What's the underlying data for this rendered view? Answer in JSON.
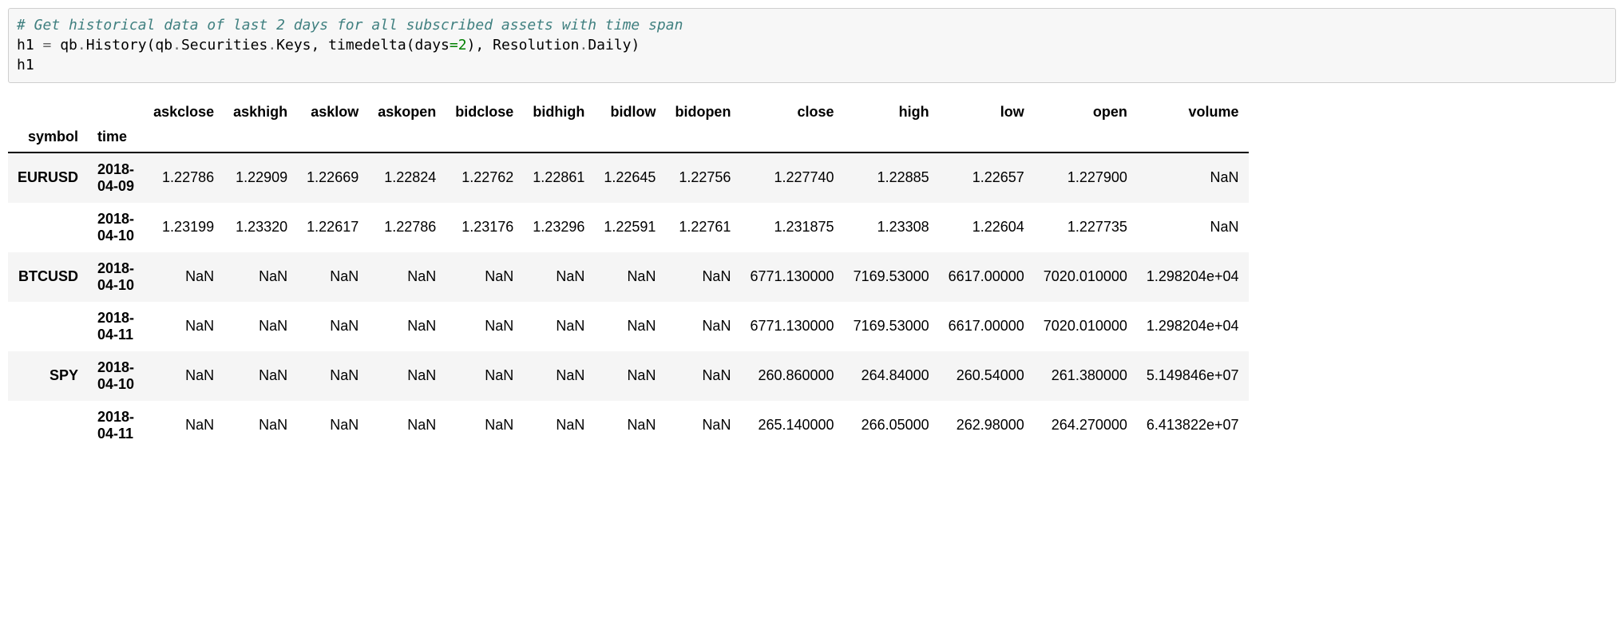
{
  "code": {
    "comment": "# Get historical data of last 2 days for all subscribed assets with time span",
    "line2_pre": "h1 ",
    "line2_eq": "=",
    "line2_a": " qb",
    "line2_dot1": ".",
    "line2_b": "History(qb",
    "line2_dot2": ".",
    "line2_c": "Securities",
    "line2_dot3": ".",
    "line2_d": "Keys, timedelta(days",
    "line2_eq2": "=",
    "line2_num": "2",
    "line2_e": "), Resolution",
    "line2_dot4": ".",
    "line2_f": "Daily)",
    "line3": "h1"
  },
  "table": {
    "index_names": [
      "symbol",
      "time"
    ],
    "columns": [
      "askclose",
      "askhigh",
      "asklow",
      "askopen",
      "bidclose",
      "bidhigh",
      "bidlow",
      "bidopen",
      "close",
      "high",
      "low",
      "open",
      "volume"
    ],
    "rows": [
      {
        "symbol": "EURUSD",
        "time": "2018-04-09",
        "cells": [
          "1.22786",
          "1.22909",
          "1.22669",
          "1.22824",
          "1.22762",
          "1.22861",
          "1.22645",
          "1.22756",
          "1.227740",
          "1.22885",
          "1.22657",
          "1.227900",
          "NaN"
        ]
      },
      {
        "symbol": "",
        "time": "2018-04-10",
        "cells": [
          "1.23199",
          "1.23320",
          "1.22617",
          "1.22786",
          "1.23176",
          "1.23296",
          "1.22591",
          "1.22761",
          "1.231875",
          "1.23308",
          "1.22604",
          "1.227735",
          "NaN"
        ]
      },
      {
        "symbol": "BTCUSD",
        "time": "2018-04-10",
        "cells": [
          "NaN",
          "NaN",
          "NaN",
          "NaN",
          "NaN",
          "NaN",
          "NaN",
          "NaN",
          "6771.130000",
          "7169.53000",
          "6617.00000",
          "7020.010000",
          "1.298204e+04"
        ]
      },
      {
        "symbol": "",
        "time": "2018-04-11",
        "cells": [
          "NaN",
          "NaN",
          "NaN",
          "NaN",
          "NaN",
          "NaN",
          "NaN",
          "NaN",
          "6771.130000",
          "7169.53000",
          "6617.00000",
          "7020.010000",
          "1.298204e+04"
        ]
      },
      {
        "symbol": "SPY",
        "time": "2018-04-10",
        "cells": [
          "NaN",
          "NaN",
          "NaN",
          "NaN",
          "NaN",
          "NaN",
          "NaN",
          "NaN",
          "260.860000",
          "264.84000",
          "260.54000",
          "261.380000",
          "5.149846e+07"
        ]
      },
      {
        "symbol": "",
        "time": "2018-04-11",
        "cells": [
          "NaN",
          "NaN",
          "NaN",
          "NaN",
          "NaN",
          "NaN",
          "NaN",
          "NaN",
          "265.140000",
          "266.05000",
          "262.98000",
          "264.270000",
          "6.413822e+07"
        ]
      }
    ]
  }
}
